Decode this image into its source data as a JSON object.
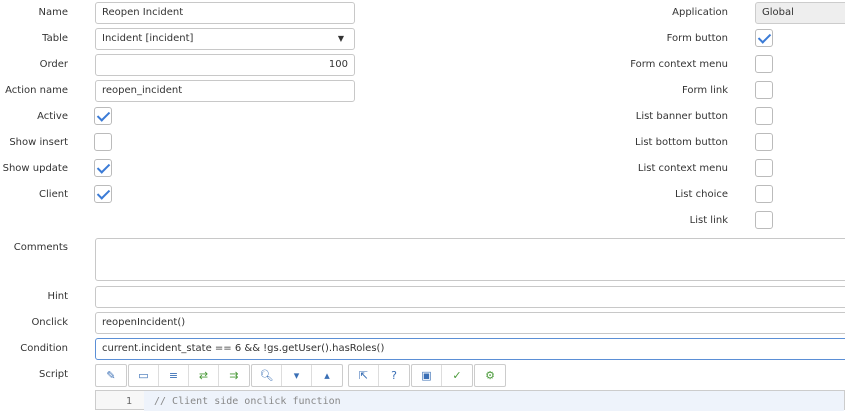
{
  "left": {
    "name": {
      "label": "Name",
      "value": "Reopen Incident"
    },
    "table": {
      "label": "Table",
      "value": "Incident [incident]"
    },
    "order": {
      "label": "Order",
      "value": "100"
    },
    "action_name": {
      "label": "Action name",
      "value": "reopen_incident"
    },
    "active": {
      "label": "Active",
      "checked": true
    },
    "show_insert": {
      "label": "Show insert",
      "checked": false
    },
    "show_update": {
      "label": "Show update",
      "checked": true
    },
    "client": {
      "label": "Client",
      "checked": true
    },
    "comments": {
      "label": "Comments",
      "value": ""
    },
    "hint": {
      "label": "Hint",
      "value": ""
    },
    "onclick": {
      "label": "Onclick",
      "value": "reopenIncident()"
    },
    "condition": {
      "label": "Condition",
      "value": "current.incident_state == 6 && !gs.getUser().hasRoles()"
    },
    "script": {
      "label": "Script",
      "line_no": "1",
      "first_line": "// Client side onclick function"
    }
  },
  "right": {
    "application": {
      "label": "Application",
      "value": "Global"
    },
    "checkboxes": [
      {
        "label": "Form button",
        "checked": true
      },
      {
        "label": "Form context menu",
        "checked": false
      },
      {
        "label": "Form link",
        "checked": false
      },
      {
        "label": "List banner button",
        "checked": false
      },
      {
        "label": "List bottom button",
        "checked": false
      },
      {
        "label": "List context menu",
        "checked": false
      },
      {
        "label": "List choice",
        "checked": false
      },
      {
        "label": "List link",
        "checked": false
      }
    ]
  }
}
